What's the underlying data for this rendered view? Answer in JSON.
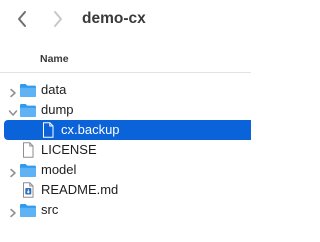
{
  "window": {
    "title": "demo-cx",
    "back_icon": "chevron-left-icon",
    "forward_icon": "chevron-right-icon"
  },
  "columns": {
    "name": "Name"
  },
  "files": [
    {
      "name": "data",
      "kind": "folder",
      "expanded": false,
      "depth": 0,
      "selected": false
    },
    {
      "name": "dump",
      "kind": "folder",
      "expanded": true,
      "depth": 0,
      "selected": false
    },
    {
      "name": "cx.backup",
      "kind": "document",
      "depth": 1,
      "selected": true
    },
    {
      "name": "LICENSE",
      "kind": "document",
      "depth": 0,
      "selected": false
    },
    {
      "name": "model",
      "kind": "folder",
      "expanded": false,
      "depth": 0,
      "selected": false
    },
    {
      "name": "README.md",
      "kind": "markdown-document",
      "depth": 0,
      "selected": false
    },
    {
      "name": "src",
      "kind": "folder",
      "expanded": false,
      "depth": 0,
      "selected": false
    }
  ],
  "colors": {
    "selection": "#0a63d9",
    "folder": "#2f9bf0",
    "chevron": "#8e8e93"
  }
}
